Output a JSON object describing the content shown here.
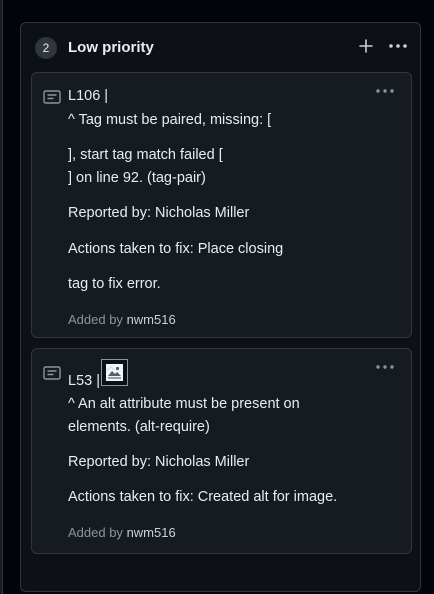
{
  "column": {
    "count": "2",
    "title": "Low priority"
  },
  "cards": [
    {
      "title": "L106 |",
      "lines": [
        "^ Tag must be paired, missing: [",
        "], start tag match failed [",
        "] on line 92. (tag-pair)",
        "Reported by: Nicholas Miller",
        "Actions taken to fix: Place closing",
        "tag to fix error."
      ],
      "added_prefix": "Added by",
      "added_user": "nwm516"
    },
    {
      "title": "L53 |",
      "lines": [
        "^ An alt attribute must be present on",
        "elements. (alt-require)",
        "Reported by: Nicholas Miller",
        "Actions taken to fix: Created alt for image."
      ],
      "added_prefix": "Added by",
      "added_user": "nwm516"
    }
  ],
  "icons": {
    "add": "plus-icon",
    "column_menu": "kebab-horizontal-icon",
    "card_menu": "kebab-horizontal-icon",
    "note": "note-icon",
    "image": "broken-image-icon"
  },
  "colors": {
    "background": "#010409",
    "column": "#0d1117",
    "card": "#161b22",
    "border": "#30363d",
    "text": "#e6edf3",
    "muted": "#8b949e"
  }
}
